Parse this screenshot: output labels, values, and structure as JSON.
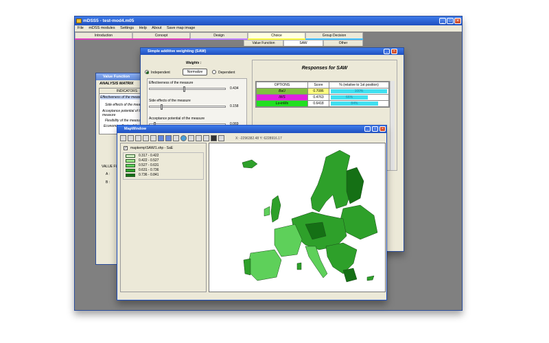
{
  "main_window": {
    "title": "mDSS5 - test-mod4.m05",
    "menu": [
      "File",
      "mDSS modules",
      "Settings",
      "Help",
      "About",
      "Save map image"
    ],
    "tabs": [
      "Introduction",
      "Concept",
      "Design",
      "Choice",
      "Group Decision"
    ],
    "subtabs": [
      "Value Function",
      "SAW",
      "Other"
    ],
    "tab_colors": [
      "#e040c0",
      "#e040c0",
      "#c080ff",
      "#ffff40",
      "#40c0ff"
    ]
  },
  "value_function": {
    "title": "Value Function",
    "heading": "ANALYSIS MATRIX",
    "col_header": "INDICATORS",
    "rows": [
      "Effectiveness of the measure",
      "Side effects of the measure",
      "Acceptance potential of the measure",
      "Flexibility of the measure",
      "Economic effects of the me"
    ],
    "value_label": "VALUE FU",
    "a_label": "A :",
    "b_label": "B :"
  },
  "saw": {
    "title": "Simple additive weighting (SAW)",
    "weights_label": "Weights :",
    "independent": "Independent",
    "normalize": "Normalize",
    "dependent": "Dependent",
    "sliders": [
      {
        "label": "Effectiveness of the measure",
        "value": "0.434",
        "level": 0.45
      },
      {
        "label": "Side effects of the measure",
        "value": "0.158",
        "level": 0.15
      },
      {
        "label": "Acceptance potential of the measure",
        "value": "0.069",
        "level": 0.06
      }
    ],
    "responses_title": "Responses for SAW",
    "table_headers": [
      "OPTIONS",
      "Score",
      "% (relative to 1st position)"
    ],
    "table_rows": [
      {
        "option": "BaU",
        "score": "0.7086",
        "pct": "100%",
        "color": "#80c040"
      },
      {
        "option": "IWS",
        "score": "0.4763",
        "pct": "66%",
        "color": "#e020e0"
      },
      {
        "option": "Lo-inWs",
        "score": "0.6418",
        "pct": "84%",
        "color": "#20e020"
      }
    ]
  },
  "map_window": {
    "title": "MapWindow",
    "coords": "X: -2296382.48  Y: 6228916.17",
    "layer_name": "mapkemp\\SAW/1.shp - SaE",
    "legend": [
      {
        "label": "0.317 - 0.422",
        "color": "#d4f2c4"
      },
      {
        "label": "0.422 - 0.527",
        "color": "#9de88a"
      },
      {
        "label": "0.527 - 0.631",
        "color": "#5ed05a"
      },
      {
        "label": "0.631 - 0.736",
        "color": "#2ea02a"
      },
      {
        "label": "0.736 - 0.841",
        "color": "#157015"
      }
    ]
  }
}
